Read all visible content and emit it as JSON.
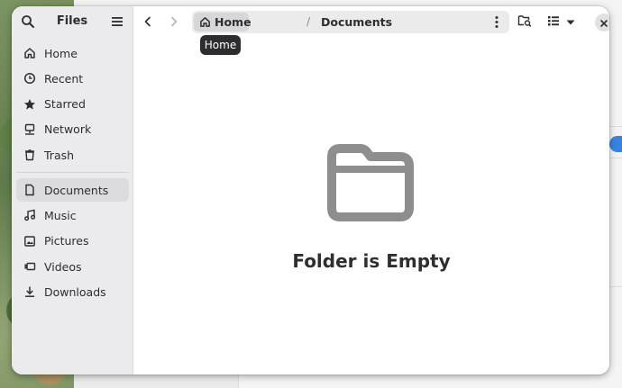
{
  "window": {
    "title": "Files"
  },
  "sidebar": {
    "places": [
      {
        "label": "Home",
        "icon": "home-icon"
      },
      {
        "label": "Recent",
        "icon": "clock-icon"
      },
      {
        "label": "Starred",
        "icon": "star-icon"
      },
      {
        "label": "Network",
        "icon": "network-icon"
      },
      {
        "label": "Trash",
        "icon": "trash-icon"
      }
    ],
    "bookmarks": [
      {
        "label": "Documents",
        "icon": "document-icon",
        "active": true
      },
      {
        "label": "Music",
        "icon": "music-icon"
      },
      {
        "label": "Pictures",
        "icon": "picture-icon"
      },
      {
        "label": "Videos",
        "icon": "video-icon"
      },
      {
        "label": "Downloads",
        "icon": "download-icon"
      }
    ]
  },
  "pathbar": {
    "home_label": "Home",
    "separator": "/",
    "current_label": "Documents"
  },
  "tooltip": {
    "text": "Home"
  },
  "empty_state": {
    "message": "Folder is Empty"
  },
  "colors": {
    "accent": "#3584e4",
    "sidebar_bg": "#ebebed",
    "active_item": "#dcdcde",
    "empty_icon": "#8e8e8e"
  }
}
